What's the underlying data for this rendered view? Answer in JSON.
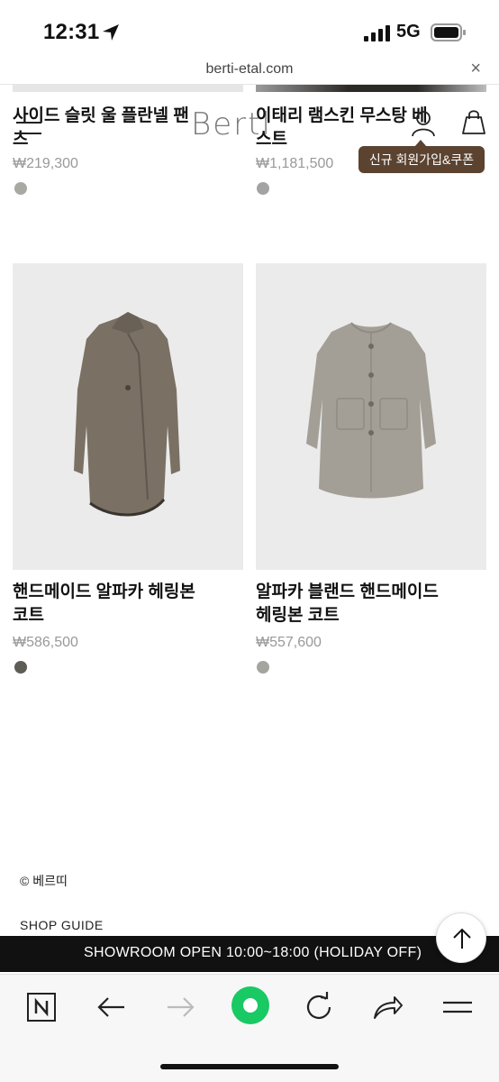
{
  "status_bar": {
    "time": "12:31",
    "network": "5G"
  },
  "browser": {
    "url": "berti-etal.com",
    "close_label": "×"
  },
  "header": {
    "logo": "Bertl",
    "coupon_label": "신규 회원가입&쿠폰"
  },
  "products": [
    {
      "name_line1": "사이드 슬릿 울 플란넬 팬",
      "name_line2": "츠",
      "price": "₩219,300",
      "swatch": "#a9a9a4"
    },
    {
      "name_line1": "이태리 램스킨 무스탕 베",
      "name_line2": "스트",
      "price": "₩1,181,500",
      "swatch": "#a3a3a3"
    },
    {
      "name_line1": "핸드메이드 알파카 헤링본",
      "name_line2": "코트",
      "price": "₩586,500",
      "swatch": "#5d5d56"
    },
    {
      "name_line1": "알파카 블랜드 핸드메이드",
      "name_line2": "헤링본 코트",
      "price": "₩557,600",
      "swatch": "#a5a5a0"
    }
  ],
  "footer": {
    "copyright": "© 베르띠",
    "shop_guide": "SHOP GUIDE",
    "showroom": "SHOWROOM OPEN 10:00~18:00 (HOLIDAY OFF)"
  },
  "colors": {
    "accent_brown": "#5b4330",
    "bar_black": "#111111",
    "green": "#18c964"
  }
}
